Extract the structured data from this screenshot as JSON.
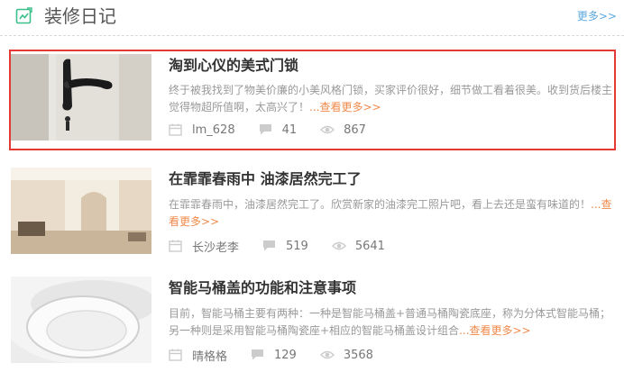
{
  "header": {
    "title": "装修日记",
    "more": "更多>>"
  },
  "items": [
    {
      "title": "淘到心仪的美式门锁",
      "description": "终于被我找到了物美价廉的小美风格门锁，买家评价很好，细节做工看着很美。收到货后楼主觉得物超所值啊，太高兴了！",
      "read_more": "...查看更多>>",
      "author": "lm_628",
      "comments": "41",
      "views": "867"
    },
    {
      "title": "在霏霏春雨中 油漆居然完工了",
      "description": "在霏霏春雨中，油漆居然完工了。欣赏新家的油漆完工照片吧，看上去还是蛮有味道的！",
      "read_more": "...查看更多>>",
      "author": "长沙老李",
      "comments": "519",
      "views": "5641"
    },
    {
      "title": "智能马桶盖的功能和注意事项",
      "description": "目前，智能马桶主要有两种：一种是智能马桶盖+普通马桶陶瓷底座，称为分体式智能马桶；另一种则是采用智能马桶陶瓷座+相应的智能马桶盖设计组合",
      "read_more": "...查看更多>>",
      "author": "晴格格",
      "comments": "129",
      "views": "3568"
    }
  ]
}
